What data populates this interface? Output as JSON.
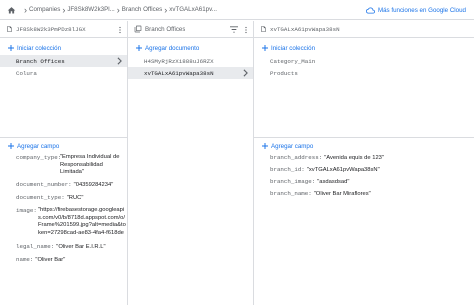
{
  "breadcrumbs": {
    "items": [
      "Companies",
      "JF8Sk8W2k3Pl...",
      "Branch Offices",
      "xvTGALxA61pv..."
    ]
  },
  "header": {
    "cloud_label": "Más funciones en Google Cloud"
  },
  "col1": {
    "title": "JF8Sk8W2k3PmPDz8lJGX",
    "add_collection": "Iniciar colección",
    "collections": [
      "Branch Offices",
      "Colura"
    ],
    "add_field": "Agregar campo",
    "fields": {
      "company_type_key": "company_type:",
      "company_type_val": "\"Empresa Individual de Responsabilidad Limitada\"",
      "document_number_key": "document_number:",
      "document_number_val": "\"04359284234\"",
      "document_type_key": "document_type:",
      "document_type_val": "\"RUC\"",
      "image_key": "image:",
      "image_val": "\"https://firebasestorage.googleapis.com/v0/b/8718d.appspot.com/o/Frame%201599.jpg?alt=media&token=27298cad-ae83-4fa4-f618de2e85f0\"",
      "legal_name_key": "legal_name:",
      "legal_name_val": "\"Oliver Bar E.I.R.L\"",
      "name_key": "name:",
      "name_val": "\"Oliver Bar\""
    }
  },
  "col2": {
    "title": "Branch Offices",
    "add_document": "Agregar documento",
    "documents": [
      "H4SMyRjRzXi888uJ6RZX",
      "xvTGALxA61pvWapa38sN"
    ]
  },
  "col3": {
    "title": "xvTGALxA61pvWapa38sN",
    "add_collection": "Iniciar colección",
    "collections": [
      "Category_Main",
      "Products"
    ],
    "add_field": "Agregar campo",
    "fields": {
      "branch_address_key": "branch_address:",
      "branch_address_val": "\"Avenida equis de 123\"",
      "branch_id_key": "branch_id:",
      "branch_id_val": "\"xvTGALxA61pvWapa38sN\"",
      "branch_image_key": "branch_image:",
      "branch_image_val": "\"asdasdsad\"",
      "branch_name_key": "branch_name:",
      "branch_name_val": "\"Oliver Bar Miraflores\""
    }
  },
  "colors": {
    "accent": "#1a73e8",
    "selected": "#e8eaed",
    "border": "#dadce0",
    "muted": "#5f6368"
  }
}
